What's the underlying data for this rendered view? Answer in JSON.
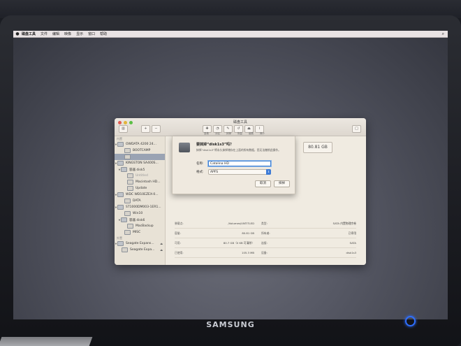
{
  "menubar": {
    "apple_icon": "apple-icon",
    "items": [
      "磁盘工具",
      "文件",
      "编辑",
      "映像",
      "显示",
      "窗口",
      "帮助"
    ]
  },
  "window": {
    "title": "磁盘工具",
    "toolbar_labels": [
      "急救",
      "分区",
      "抹掉",
      "恢复",
      "装载",
      "简介"
    ],
    "sidebar": {
      "internal_header": "内置",
      "external_header": "外置",
      "items": [
        {
          "label": "OWDATA 4200 24...",
          "type": "disk"
        },
        {
          "label": "BOOTCAMP",
          "type": "volume"
        },
        {
          "label": "",
          "type": "volume",
          "selected": true
        },
        {
          "label": "KINGSTON SA400S...",
          "type": "disk"
        },
        {
          "label": "容器 disk5",
          "type": "container"
        },
        {
          "label": "Untitled",
          "type": "volume"
        },
        {
          "label": "Macintosh HD...",
          "type": "volume"
        },
        {
          "label": "Update",
          "type": "volume"
        },
        {
          "label": "WDC WD10EZEX-0...",
          "type": "disk"
        },
        {
          "label": "DATA",
          "type": "volume"
        },
        {
          "label": "ST1000DM003-1ER1...",
          "type": "disk"
        },
        {
          "label": "Win10",
          "type": "volume"
        },
        {
          "label": "容器 disk6",
          "type": "container"
        },
        {
          "label": "MacBackup",
          "type": "volume"
        },
        {
          "label": "MISC",
          "type": "volume"
        },
        {
          "label": "Seagate Expans...",
          "type": "external"
        },
        {
          "label": "Seagate Expa...",
          "type": "external"
        }
      ]
    },
    "size": "80.81 GB",
    "info": [
      {
        "label": "装载点:",
        "value": "/Volumes/UNTITLED",
        "label2": "类型:",
        "value2": "SATA 内置物理宗卷"
      },
      {
        "label": "容量:",
        "value": "80.81 GB",
        "label2": "所有者:",
        "value2": "已停用"
      },
      {
        "label": "可用:",
        "value": "80.7 GB（0 KB 可清除）",
        "label2": "连接:",
        "value2": "SATA"
      },
      {
        "label": "已使用:",
        "value": "105.3 MB",
        "label2": "设备:",
        "value2": "disk1s3"
      }
    ]
  },
  "sheet": {
    "title": "要抹掉“disk1s3”吗？",
    "description": "抹掉“disk1s3”将永久抹掉储存在上面的所有数据，您无法撤销此操作。",
    "name_label": "名称:",
    "name_value": "Catalina HD",
    "format_label": "格式:",
    "format_value": "APFS",
    "cancel_label": "取消",
    "erase_label": "抹掉"
  },
  "monitor": {
    "brand": "SAMSUNG"
  },
  "colors": {
    "selection": "#9aa3b3",
    "accent": "#3d7bd6",
    "power_led": "#2f6fff"
  }
}
